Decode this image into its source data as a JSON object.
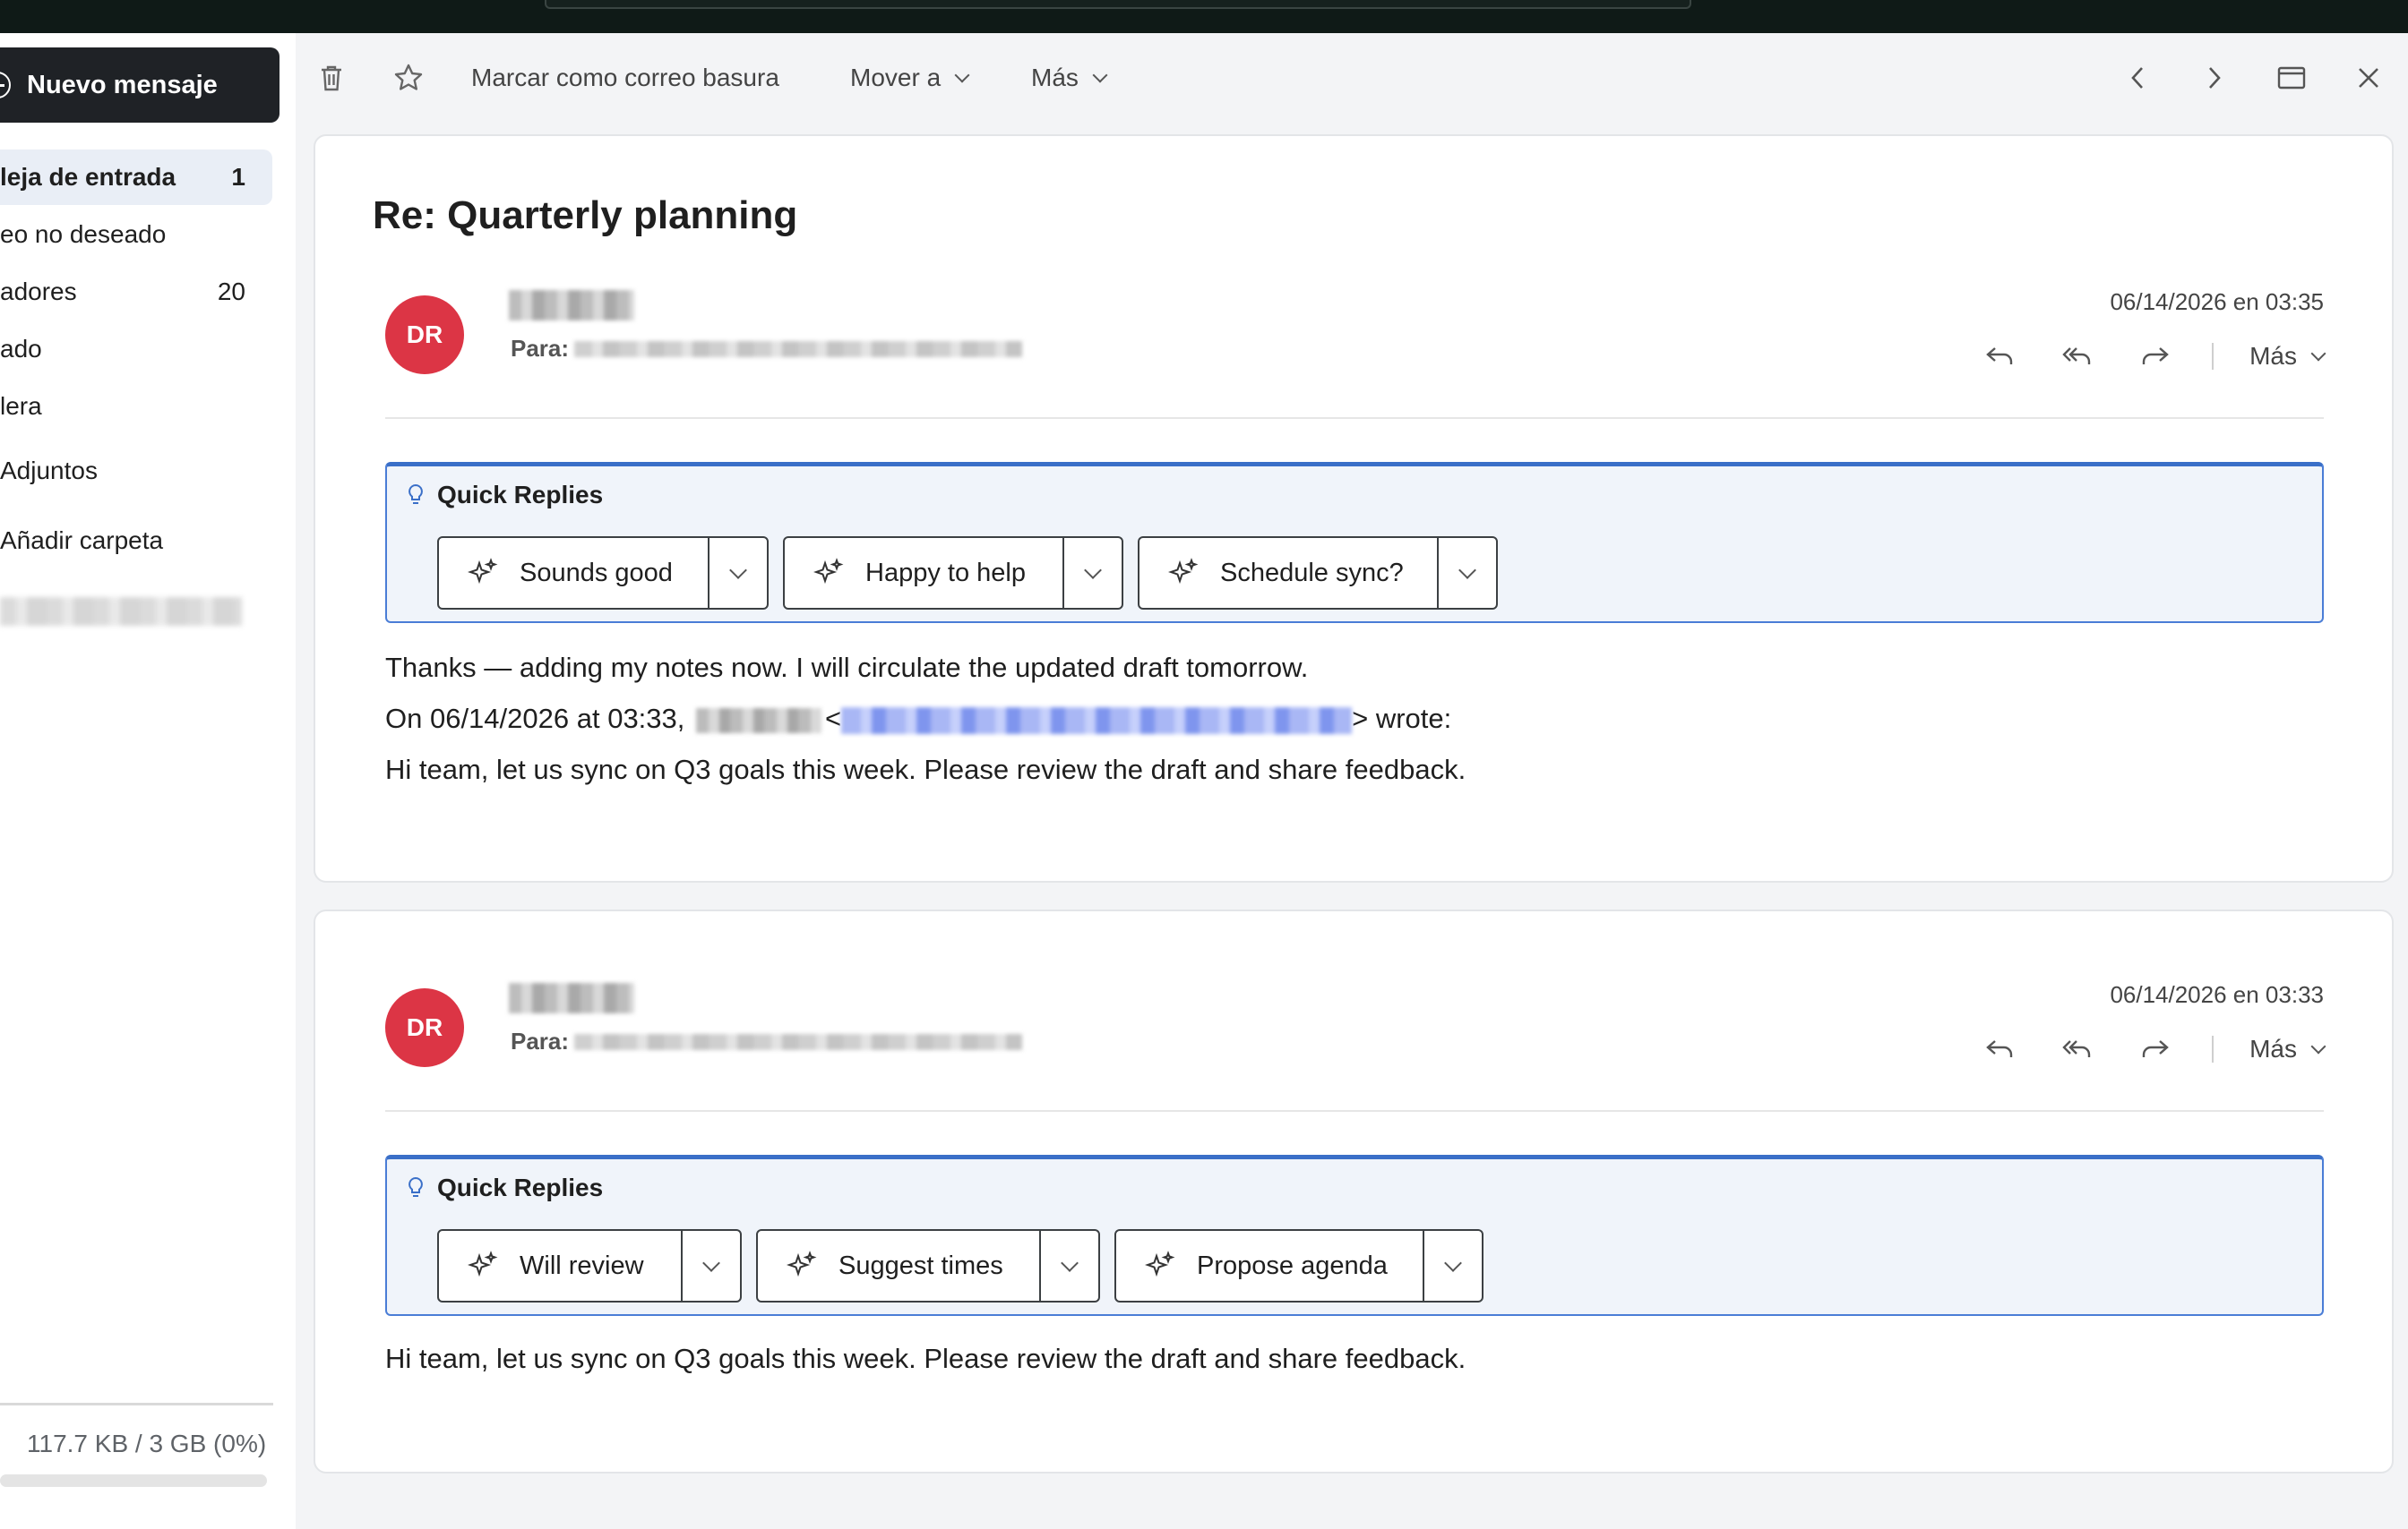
{
  "toolbar": {
    "compose_label": "Nuevo mensaje",
    "spam_label": "Marcar como correo basura",
    "move_label": "Mover a",
    "more_label": "Más"
  },
  "sidebar": {
    "folders": [
      {
        "label": "leja de entrada",
        "count": "1"
      },
      {
        "label": "eo no deseado",
        "count": ""
      },
      {
        "label": "adores",
        "count": "20"
      },
      {
        "label": "ado",
        "count": ""
      },
      {
        "label": "lera",
        "count": ""
      },
      {
        "label": "Adjuntos",
        "count": ""
      },
      {
        "label": "Añadir carpeta",
        "count": ""
      }
    ],
    "storage": {
      "text": "117.7 KB / 3 GB (0%)",
      "percent": 0
    }
  },
  "thread": {
    "subject": "Re: Quarterly planning",
    "messages": [
      {
        "avatar_initials": "DR",
        "to_label": "Para:",
        "date": "06/14/2026 en 03:35",
        "more_label": "Más",
        "quick_replies_title": "Quick Replies",
        "quick_replies": [
          "Sounds good",
          "Happy to help",
          "Schedule sync?"
        ],
        "body": {
          "line1": "Thanks — adding my notes now. I will circulate the updated draft tomorrow.",
          "quote_prefix": "On 06/14/2026 at 03:33,",
          "quote_lt": "<",
          "quote_suffix": "> wrote:",
          "line3": "Hi team, let us sync on Q3 goals this week. Please review the draft and share feedback."
        }
      },
      {
        "avatar_initials": "DR",
        "to_label": "Para:",
        "date": "06/14/2026 en 03:33",
        "more_label": "Más",
        "quick_replies_title": "Quick Replies",
        "quick_replies": [
          "Will review",
          "Suggest times",
          "Propose agenda"
        ],
        "body": {
          "line1": "Hi team, let us sync on Q3 goals this week. Please review the draft and share feedback."
        }
      }
    ]
  },
  "icons": {
    "trash": "trash-icon",
    "star": "star-icon",
    "prev": "chevron-left-icon",
    "next": "chevron-right-icon",
    "expand": "window-icon",
    "close": "close-icon",
    "reply": "reply-icon",
    "reply_all": "reply-all-icon",
    "forward": "forward-icon",
    "bulb": "lightbulb-icon",
    "sparkle": "sparkle-icon"
  },
  "colors": {
    "avatar": "#dc3545",
    "accent": "#3a6fc8",
    "compose_bg": "#1f2226"
  }
}
